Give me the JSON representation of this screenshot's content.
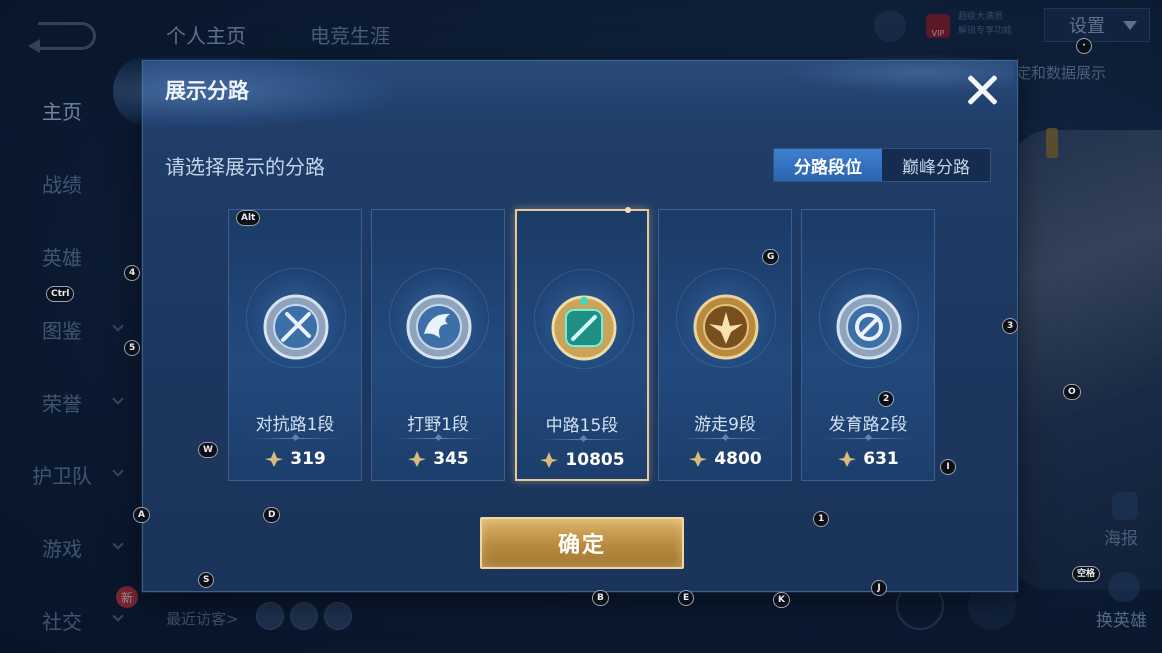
{
  "top_nav": {
    "tabs": [
      {
        "label": "个人主页"
      },
      {
        "label": "电竞生涯"
      }
    ],
    "vip_badge": "VIP",
    "vip_lines": [
      "超级大满贯",
      "解锁专享功能"
    ],
    "settings_label": "设置",
    "right_hint": "定和数据展示"
  },
  "side_nav": {
    "items": [
      {
        "label": "主页"
      },
      {
        "label": "战绩"
      },
      {
        "label": "英雄"
      },
      {
        "label": "图鉴"
      },
      {
        "label": "荣誉"
      },
      {
        "label": "护卫队"
      },
      {
        "label": "游戏"
      },
      {
        "label": "社交"
      }
    ],
    "new_tag": "新"
  },
  "bottom": {
    "recent_visitors": "最近访客>",
    "poster": "海报",
    "swap_hero": "换英雄"
  },
  "modal": {
    "title": "展示分路",
    "subtitle": "请选择展示的分路",
    "toggle": [
      {
        "label": "分路段位",
        "active": true
      },
      {
        "label": "巅峰分路",
        "active": false
      }
    ],
    "cards": [
      {
        "label": "对抗路1段",
        "score": "319",
        "icon": "silver-sword-emblem-icon",
        "selected": false
      },
      {
        "label": "打野1段",
        "score": "345",
        "icon": "silver-dragon-emblem-icon",
        "selected": false
      },
      {
        "label": "中路15段",
        "score": "10805",
        "icon": "jade-gold-emblem-icon",
        "selected": true
      },
      {
        "label": "游走9段",
        "score": "4800",
        "icon": "gold-wing-emblem-icon",
        "selected": false
      },
      {
        "label": "发育路2段",
        "score": "631",
        "icon": "silver-circle-emblem-icon",
        "selected": false
      }
    ],
    "confirm_label": "确定"
  },
  "key_hints": {
    "alt": "Alt",
    "ctrl": "Ctrl",
    "space": "空格",
    "k4": "4",
    "k5": "5",
    "k3": "3",
    "k2": "2",
    "k1": "1",
    "w": "W",
    "a": "A",
    "d": "D",
    "s": "S",
    "b": "B",
    "e": "E",
    "k": "K",
    "j": "J",
    "g": "G",
    "i": "I",
    "o": "O",
    "dot": "·"
  },
  "colors": {
    "modal_bg": "#1d3860",
    "toggle_active": "#3a76c4",
    "confirm_gold": "#c99a4e",
    "selected_border": "#e7c79a"
  }
}
